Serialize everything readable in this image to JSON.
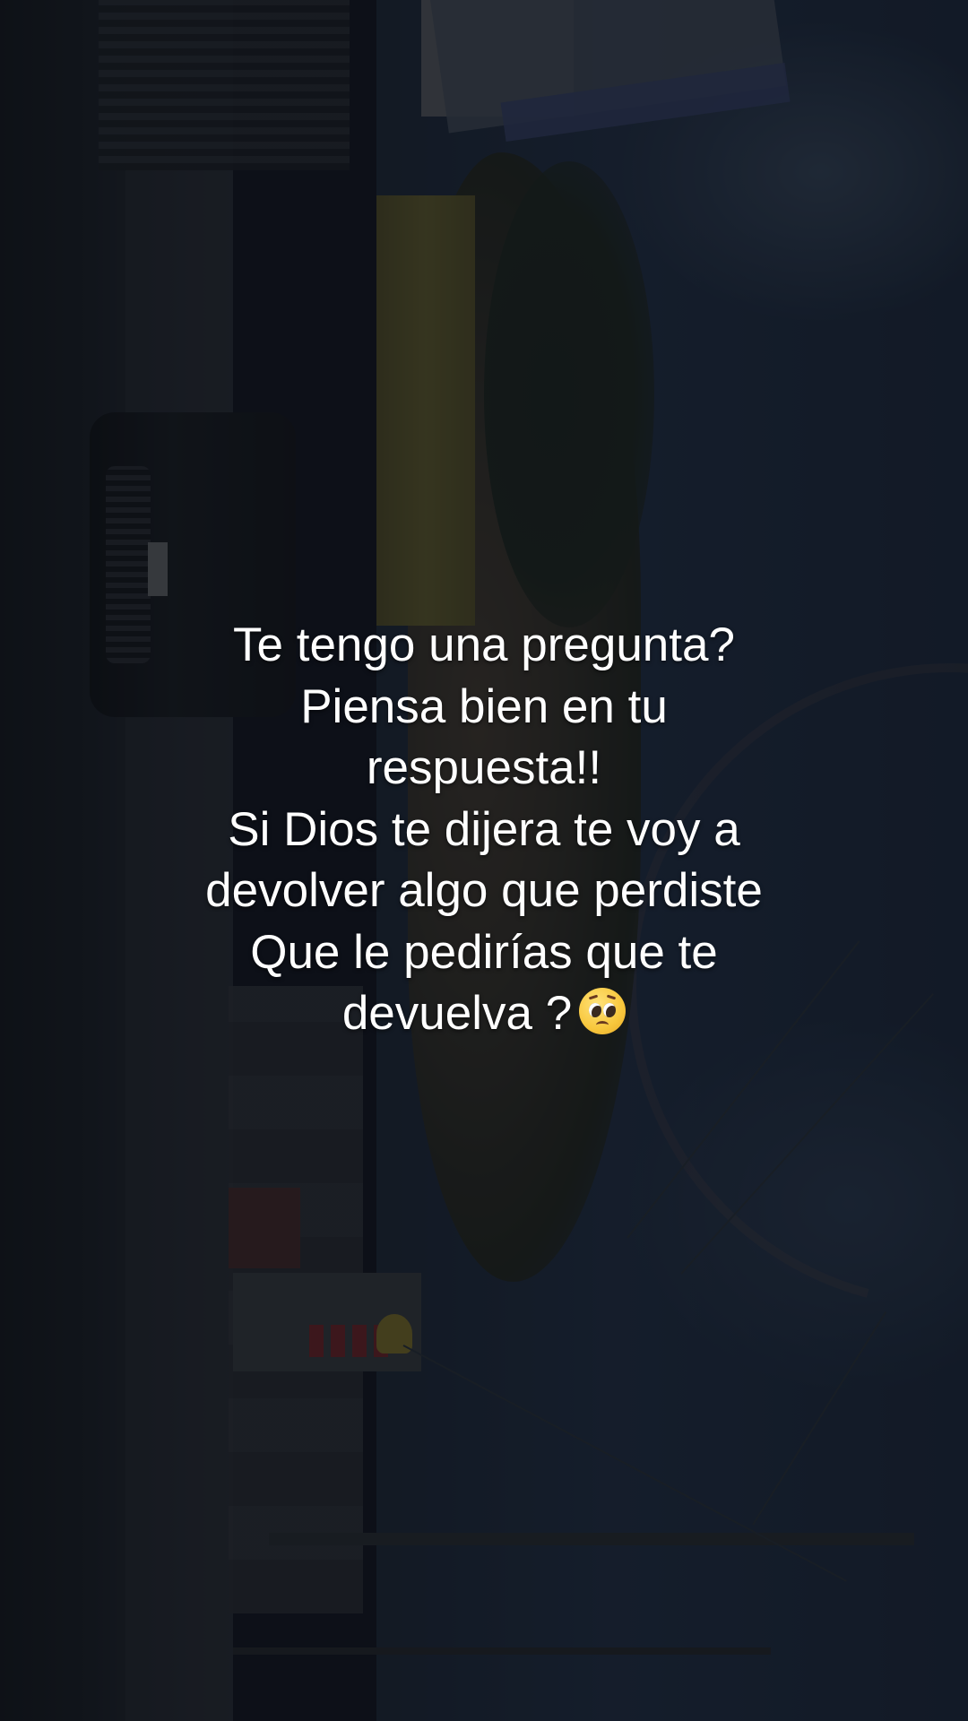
{
  "caption": {
    "lines": [
      "Te tengo una pregunta?",
      "Piensa bien en tu",
      "respuesta!!",
      "Si Dios te dijera te voy a",
      "devolver algo que perdiste",
      "Que le pedirías que te",
      "devuelva ?"
    ],
    "emoji": "pleading-face"
  },
  "background": {
    "description_icon": "street-scene-photo",
    "colors": {
      "sky": "#24324a",
      "road": "#1b1f26",
      "overlay": "#0a0c12"
    }
  }
}
